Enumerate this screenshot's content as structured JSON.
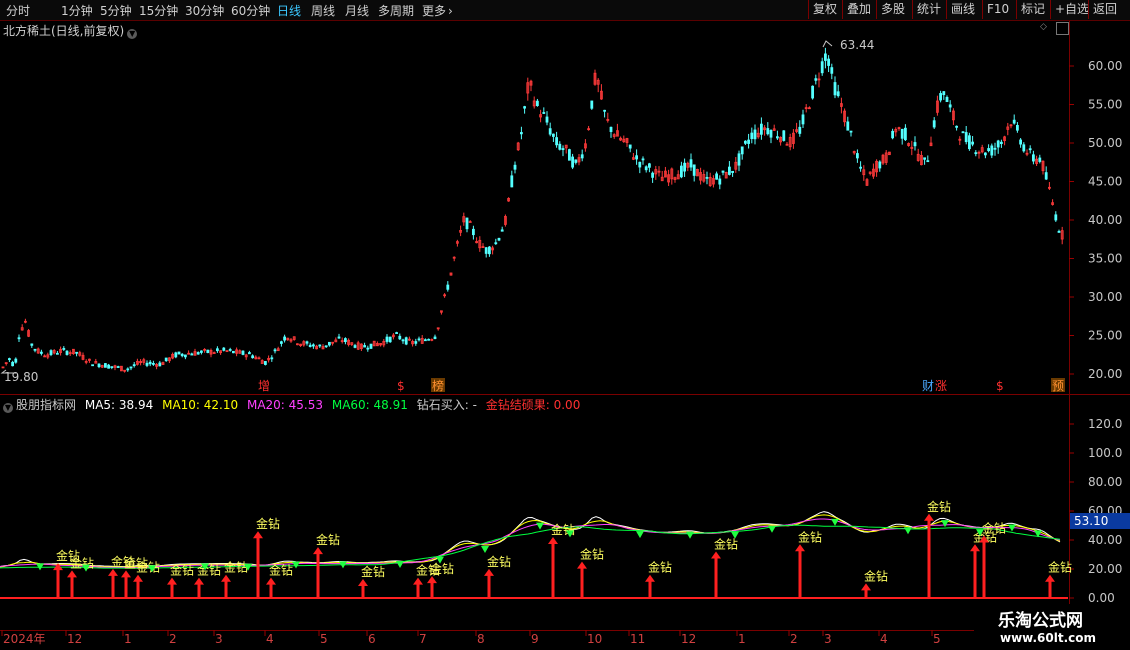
{
  "toolbar": {
    "period_tabs": [
      "分时",
      "1分钟",
      "5分钟",
      "15分钟",
      "30分钟",
      "60分钟",
      "日线",
      "周线",
      "月线",
      "多周期",
      "更多"
    ],
    "active_tab": "日线",
    "right_buttons": [
      "复权",
      "叠加",
      "多股",
      "统计",
      "画线",
      "F10",
      "标记",
      "+自选",
      "返回"
    ]
  },
  "stock": {
    "title": "北方稀土(日线,前复权)",
    "high_label": "63.44",
    "low_label": "19.80"
  },
  "price_axis": {
    "ticks": [
      "60.00",
      "55.00",
      "50.00",
      "45.00",
      "40.00",
      "35.00",
      "30.00",
      "25.00",
      "20.00"
    ]
  },
  "markers": [
    {
      "text": "增",
      "color": "#ff3030"
    },
    {
      "text": "$",
      "color": "#ff3030"
    },
    {
      "text": "榜",
      "color": "#ff9030"
    },
    {
      "text": "财",
      "color": "#4aa8ff"
    },
    {
      "text": "涨",
      "color": "#ff3030"
    },
    {
      "text": "$",
      "color": "#ff3030"
    },
    {
      "text": "预",
      "color": "#ff9030"
    }
  ],
  "indicator": {
    "name": "股朋指标网",
    "ma5": "MA5: 38.94",
    "ma10": "MA10: 42.10",
    "ma20": "MA20: 45.53",
    "ma60": "MA60: 48.91",
    "diamond": "钻石买入: -",
    "result": "金钻结硕果: 0.00",
    "colors": {
      "ma5": "#ffffff",
      "ma10": "#ffff00",
      "ma20": "#ff40ff",
      "ma60": "#00ff40",
      "diamond": "#c8c8c8",
      "result": "#ff3030"
    },
    "axis_ticks": [
      "120.0",
      "100.0",
      "80.00",
      "60.00",
      "40.00",
      "20.00",
      "0.00"
    ],
    "current_value": "53.10",
    "signal_label": "金钻"
  },
  "time_axis": {
    "labels": [
      "2024年",
      "12",
      "1",
      "2",
      "3",
      "4",
      "5",
      "6",
      "7",
      "8",
      "9",
      "10",
      "11",
      "12",
      "1",
      "2",
      "3",
      "4",
      "5"
    ]
  },
  "watermark": {
    "line1": "乐淘公式网",
    "line2": "www.60lt.com"
  }
}
